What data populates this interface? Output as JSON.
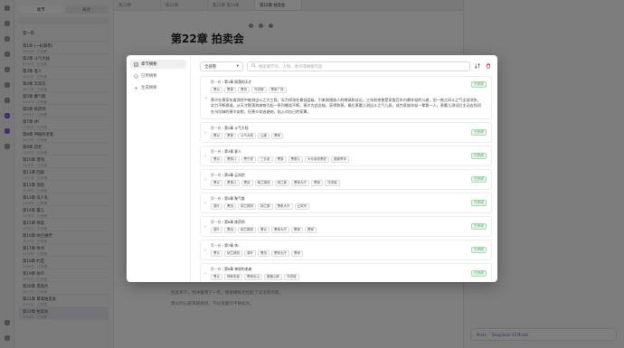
{
  "background": {
    "chapter_tabs": [
      "章节",
      "概述"
    ],
    "volume_header": "第一卷",
    "chapters": [
      {
        "title": "第1章 (一标题卷)",
        "meta": "2863字 · 已完稿"
      },
      {
        "title": "第2章 斗气大陆",
        "meta": "2950字 · 已完稿"
      },
      {
        "title": "第3章 客人",
        "meta": "3021字 · 已完稿"
      },
      {
        "title": "第4章 云岚宗",
        "meta": "2877字 · 已完稿"
      },
      {
        "title": "第5章 聚气散",
        "meta": "3102字 · 已完稿"
      },
      {
        "title": "第6章 炼药师",
        "meta": "2933字 · 已完稿"
      },
      {
        "title": "第7章 休!",
        "meta": "2760字 · 已完稿"
      },
      {
        "title": "第8章 神秘的老者",
        "meta": "3010字 · 已完稿"
      },
      {
        "title": "第9章 药老",
        "meta": "2988字 · 已完稿"
      },
      {
        "title": "第10章 借钱",
        "meta": "2845字 · 已完稿"
      },
      {
        "title": "第11章 回家",
        "meta": "2901字 · 已完稿"
      },
      {
        "title": "第12章 测验",
        "meta": "3056字 · 已完稿"
      },
      {
        "title": "第13章 成人礼",
        "meta": "2990字 · 已完稿"
      },
      {
        "title": "第14章 薰儿",
        "meta": "2870字 · 已完稿"
      },
      {
        "title": "第15章 修炼",
        "meta": "2930字 · 已完稿"
      },
      {
        "title": "第16章 纳兰嫣然",
        "meta": "3001字 · 已完稿"
      },
      {
        "title": "第17章 休书",
        "meta": "2955字 · 已完稿"
      },
      {
        "title": "第18章 约定",
        "meta": "2888字 · 已完稿"
      },
      {
        "title": "第19章 坊市",
        "meta": "2930字 · 已完稿"
      },
      {
        "title": "第20章 黑铁片",
        "meta": "2877字 · 已完稿"
      },
      {
        "title": "第21章 萧家拍卖会",
        "meta": "2866字 · 已完稿"
      },
      {
        "title": "第22章 拍卖会",
        "meta": "3004字 · 已完稿"
      }
    ],
    "window_tabs": [
      "第21章",
      "第22章",
      "第23章 第24章",
      "第22章 拍卖会"
    ],
    "editor_title": "第22章 拍卖会",
    "editor_lines": [
      "因此离下，他冲着萧了一笑，随着嘴角也挂起了淡淡的笑意。",
      "萧炎的心越来越愉悦，不过表面仍平静如水。"
    ],
    "right_bottom": [
      "Mode",
      "DeepSeek V3 Model"
    ]
  },
  "modal": {
    "nav": [
      {
        "label": "章节摘要",
        "icon": "list-icon",
        "active": true
      },
      {
        "label": "已用摘要",
        "icon": "check-icon",
        "active": false
      },
      {
        "label": "生成摘要",
        "icon": "sparkle-icon",
        "active": false
      }
    ],
    "filter": {
      "value": "全部卷"
    },
    "search": {
      "placeholder": "搜索章节名、人物、地点或摘要内容"
    },
    "cards": [
      {
        "volume": "第一卷",
        "title": "第1章 陨落的天才",
        "expanded": true,
        "status": "已完成",
        "tags": [
          "萧炎",
          "萧薰",
          "萧战",
          "乌坦城",
          "萧家广场"
        ],
        "summary": "萧炎在萧家年度测验中被测出斗之力三段，实力停滞在最低层级，引来周围族人的嘲讽和议论。三年前他曾是家族百年内最年轻的斗者，但一夜之间斗之气全部消失，实力不断倒退。从天才跌落到废物引起一系列嘲笑不断。萧炎为此苦恼，获得和萧，最后萧薰儿测出斗之气九段，成为家族年轻一辈第一人。萧薰儿测试后主动去找同在乌坦城的萧炎安慰，但萧炎却逃避她，陷入对自己的笼罩。"
      },
      {
        "volume": "第一卷",
        "title": "第2章 斗气大陆",
        "expanded": false,
        "status": "已完成",
        "tags": [
          "萧炎",
          "萧薰",
          "斗气大陆",
          "山崖",
          "萧家"
        ]
      },
      {
        "volume": "第一卷",
        "title": "第3章 客人",
        "expanded": false,
        "status": "已完成",
        "tags": [
          "萧炎",
          "萧薰儿",
          "萧宁老",
          "三长老",
          "萧族",
          "萧薰儿",
          "大长老收萧老",
          "美服青年"
        ]
      },
      {
        "volume": "第一卷",
        "title": "第4章 云岚宗",
        "expanded": false,
        "status": "已完成",
        "tags": [
          "萧炎",
          "萧薰儿",
          "萧战",
          "纳兰嫣然",
          "纳兰棠",
          "萧家大厅",
          "萧家",
          "乌坦城"
        ]
      },
      {
        "volume": "第一卷",
        "title": "第5章 聚气散",
        "expanded": false,
        "status": "已完成",
        "tags": [
          "葛叶",
          "萧战",
          "纳兰嫣然",
          "纳兰棠",
          "萧家大厅",
          "云岚宗"
        ]
      },
      {
        "volume": "第一卷",
        "title": "第6章 炼药师",
        "expanded": false,
        "status": "已完成",
        "tags": [
          "葛叶",
          "萧战",
          "纳兰嫣然",
          "萧炎",
          "萧家大厅",
          "萧家",
          "萧家"
        ]
      },
      {
        "volume": "第一卷",
        "title": "第7章 休!",
        "expanded": false,
        "status": "已完成",
        "tags": [
          "萧炎",
          "纳兰嫣然",
          "葛叶",
          "萧战",
          "萧家大厅",
          "萧家"
        ]
      },
      {
        "volume": "第一卷",
        "title": "第8章 神秘的老者",
        "expanded": false,
        "status": "已完成",
        "tags": [
          "萧炎",
          "神秘老者",
          "萧家后山",
          "魔兽山脉",
          "乌坦城"
        ]
      }
    ]
  }
}
